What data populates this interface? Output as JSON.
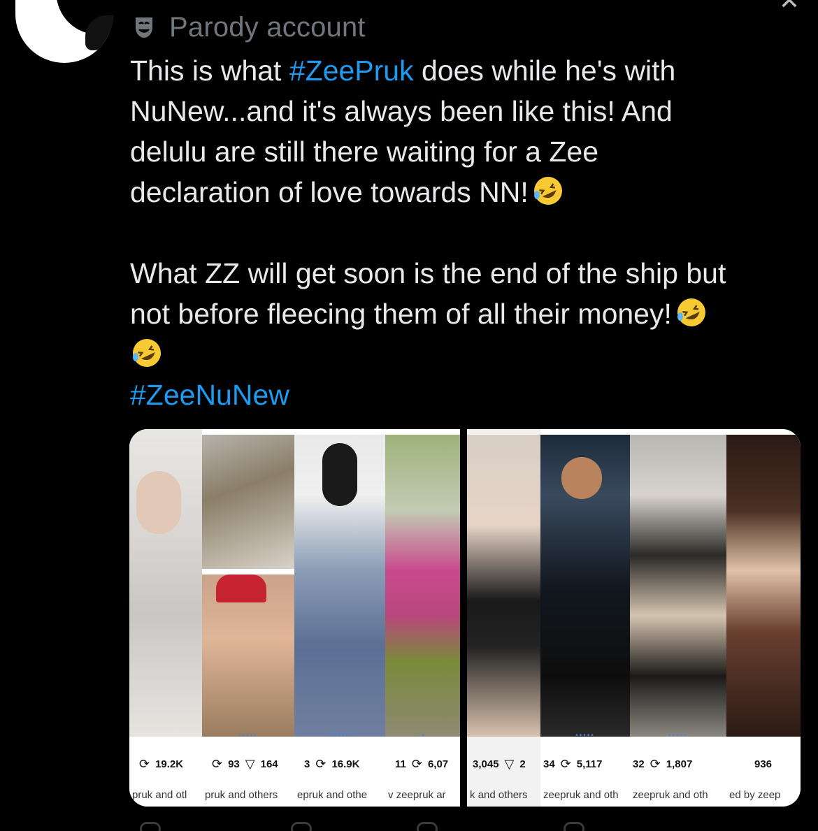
{
  "header": {
    "parody_label": "Parody account"
  },
  "tweet": {
    "line1_pre": "This is what ",
    "line1_tag": "#ZeePruk",
    "line1_post": " does while he's with",
    "line2": "NuNew...and it's always been like this! And",
    "line3": "delulu are still there waiting for a Zee",
    "line4": "declaration of love towards NN!",
    "line5": "What ZZ will get soon is the end of the ship but",
    "line6": "not before fleecing them of all their money!",
    "hashtag2": "#ZeeNuNew"
  },
  "media": {
    "cards": [
      {
        "stat1": "19.2K",
        "stat2": "",
        "by": "pruk and otl"
      },
      {
        "stat1": "93",
        "stat2": "164",
        "by": "pruk and others"
      },
      {
        "stat0": "3",
        "stat1": "16.9K",
        "stat2": "",
        "by": "epruk and othe"
      },
      {
        "stat0": "11",
        "stat1": "6,07",
        "stat2": "",
        "by": "v zeepruk ar"
      },
      {
        "stat1": "3,045",
        "stat2": "2",
        "by": "k and others"
      },
      {
        "stat0": "34",
        "stat1": "5,117",
        "stat2": "",
        "by": "zeepruk and oth"
      },
      {
        "stat0": "32",
        "stat1": "1,807",
        "stat2": "",
        "by": "zeepruk and oth"
      },
      {
        "stat1": "936",
        "stat2": "",
        "by": "ed by zeep"
      }
    ]
  },
  "colors": {
    "background": "#000000",
    "text": "#e7e9ea",
    "muted": "#71767b",
    "link": "#1d9bf0"
  }
}
